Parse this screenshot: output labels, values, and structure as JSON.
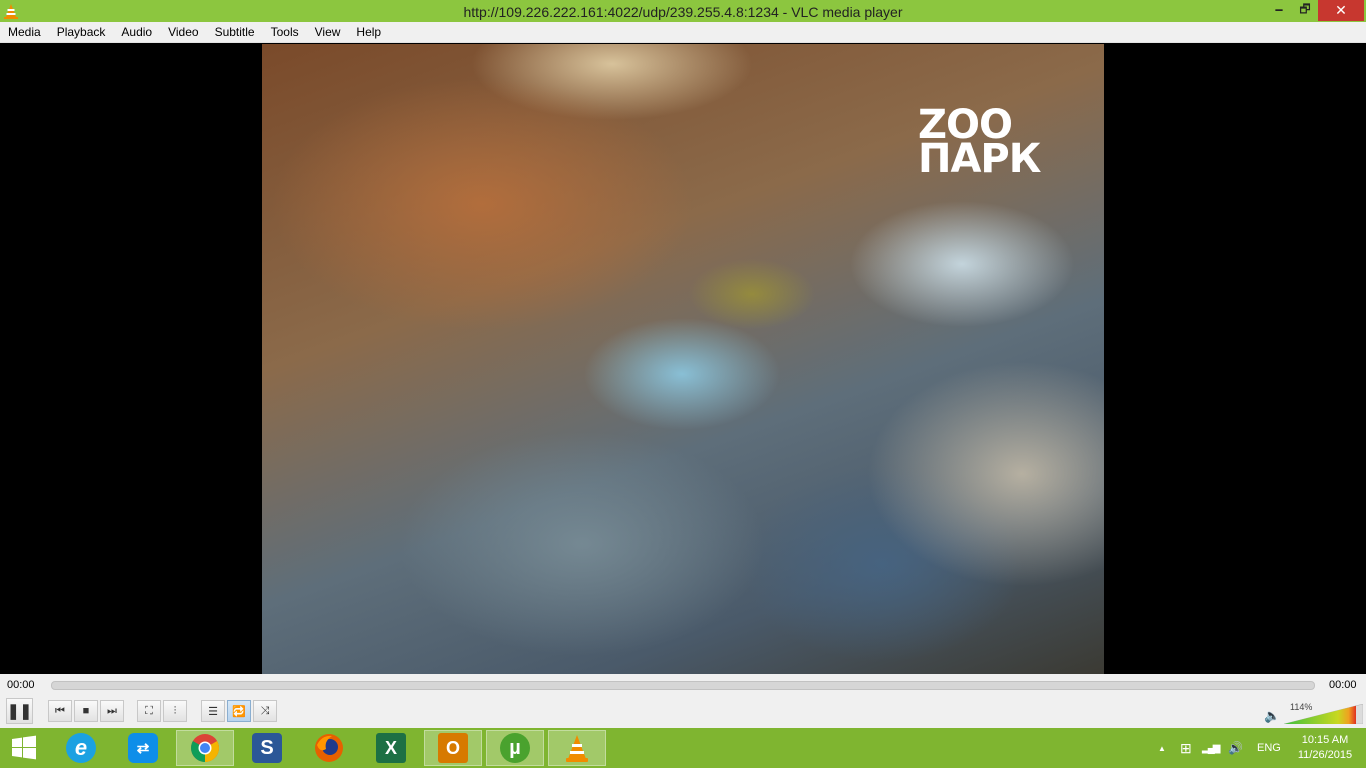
{
  "window": {
    "title": "http://109.226.222.161:4022/udp/239.255.4.8:1234 - VLC media player",
    "minimize_glyph": "🗕",
    "maximize_glyph": "🗗",
    "close_glyph": "✕"
  },
  "menu": {
    "items": [
      {
        "label": "Media"
      },
      {
        "label": "Playback"
      },
      {
        "label": "Audio"
      },
      {
        "label": "Video"
      },
      {
        "label": "Subtitle"
      },
      {
        "label": "Tools"
      },
      {
        "label": "View"
      },
      {
        "label": "Help"
      }
    ]
  },
  "video": {
    "channel_logo_line1": "ZOO",
    "channel_logo_line2": "ПАРК"
  },
  "seek": {
    "elapsed": "00:00",
    "total": "00:00",
    "progress": 0
  },
  "controls": {
    "pause_glyph": "❚❚",
    "previous_glyph": "⏮",
    "stop_glyph": "■",
    "next_glyph": "⏭",
    "fullscreen_glyph": "⛶",
    "extended_settings_glyph": "⫶",
    "playlist_glyph": "☰",
    "loop_glyph": "🔁",
    "random_glyph": "⤨",
    "loop_active": true,
    "volume_glyph": "🔈",
    "volume_percent": "114%",
    "volume_level": 1.14
  },
  "taskbar": {
    "apps": [
      {
        "name": "start-button",
        "glyph": "⊞",
        "color": "#7fb530"
      },
      {
        "name": "internet-explorer-icon",
        "glyph": "e",
        "color": "#1ba1e2"
      },
      {
        "name": "teamviewer-icon",
        "glyph": "⇄",
        "color": "#0e8ee9"
      },
      {
        "name": "chrome-icon",
        "glyph": "●",
        "color": "#db4437"
      },
      {
        "name": "app-s-icon",
        "glyph": "S",
        "color": "#2b5797"
      },
      {
        "name": "firefox-icon",
        "glyph": "●",
        "color": "#e66000"
      },
      {
        "name": "excel-icon",
        "glyph": "X",
        "color": "#1d7044"
      },
      {
        "name": "outlook-icon",
        "glyph": "O",
        "color": "#d77a00"
      },
      {
        "name": "utorrent-icon",
        "glyph": "µ",
        "color": "#4aa22e"
      },
      {
        "name": "vlc-icon",
        "glyph": "▲",
        "color": "#f08c00"
      }
    ],
    "tray": {
      "show_hidden_glyph": "▲",
      "action_center_glyph": "⊞",
      "network_glyph": "▂▄▆",
      "volume_glyph": "🔊",
      "language": "ENG"
    },
    "clock": {
      "time": "10:15 AM",
      "date": "11/26/2015"
    }
  }
}
